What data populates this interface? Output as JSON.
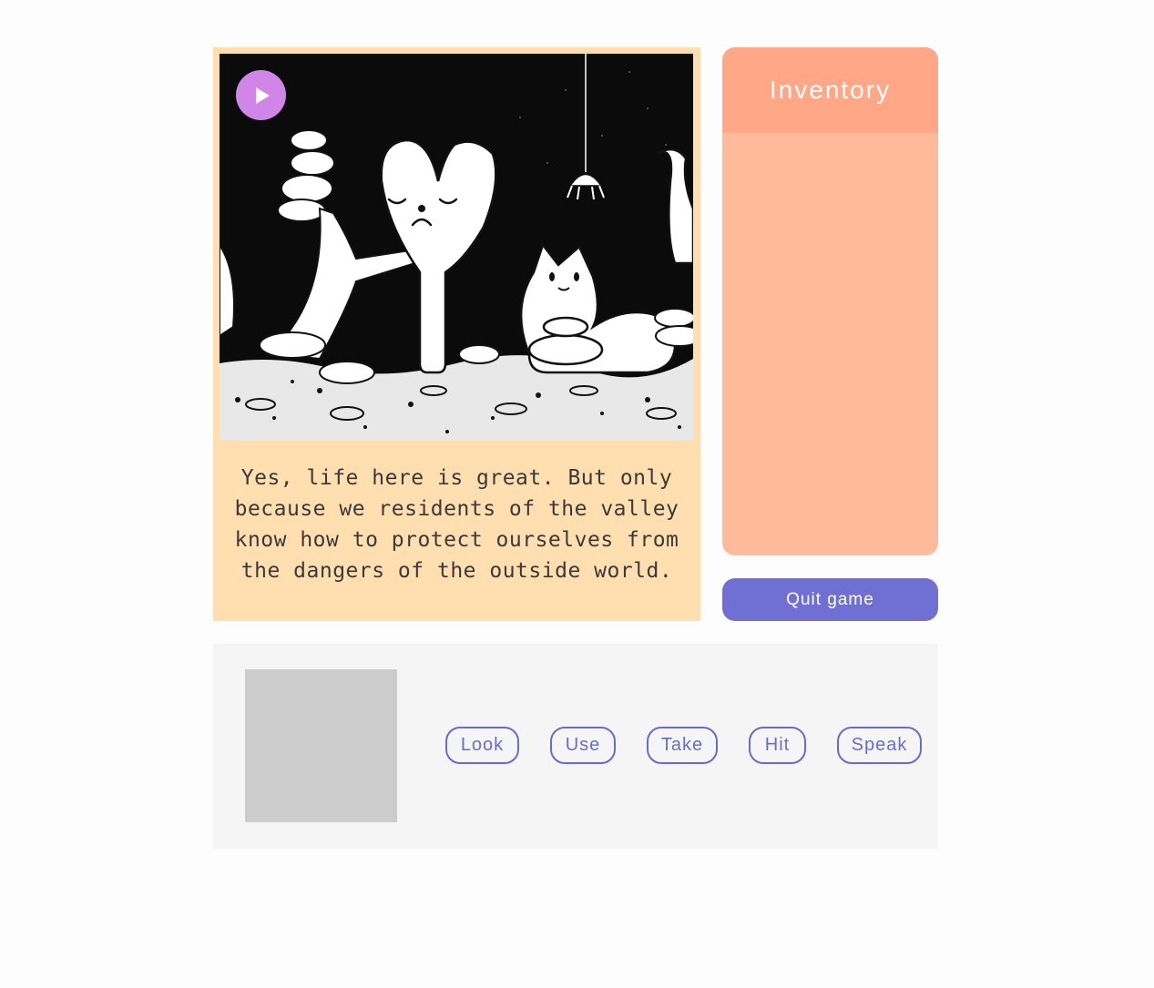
{
  "scene": {
    "narration": "Yes, life here is great. But only because we residents of the valley know how to protect ourselves from the dangers of the outside world.",
    "play_icon": "play-icon"
  },
  "inventory": {
    "title": "Inventory",
    "items": []
  },
  "controls": {
    "quit_label": "Quit game"
  },
  "actions": {
    "verbs": [
      {
        "label": "Look"
      },
      {
        "label": "Use"
      },
      {
        "label": "Take"
      },
      {
        "label": "Hit"
      },
      {
        "label": "Speak"
      }
    ]
  },
  "colors": {
    "scene_card": "#ffdfb0",
    "inventory_header": "#ffa787",
    "inventory_body": "#ffba9c",
    "quit_button": "#7070d4",
    "verb_outline": "#6b6bcf",
    "play_button": "#cf86e6",
    "action_panel": "#f5f5f5",
    "selected_slot": "#cccccc"
  }
}
